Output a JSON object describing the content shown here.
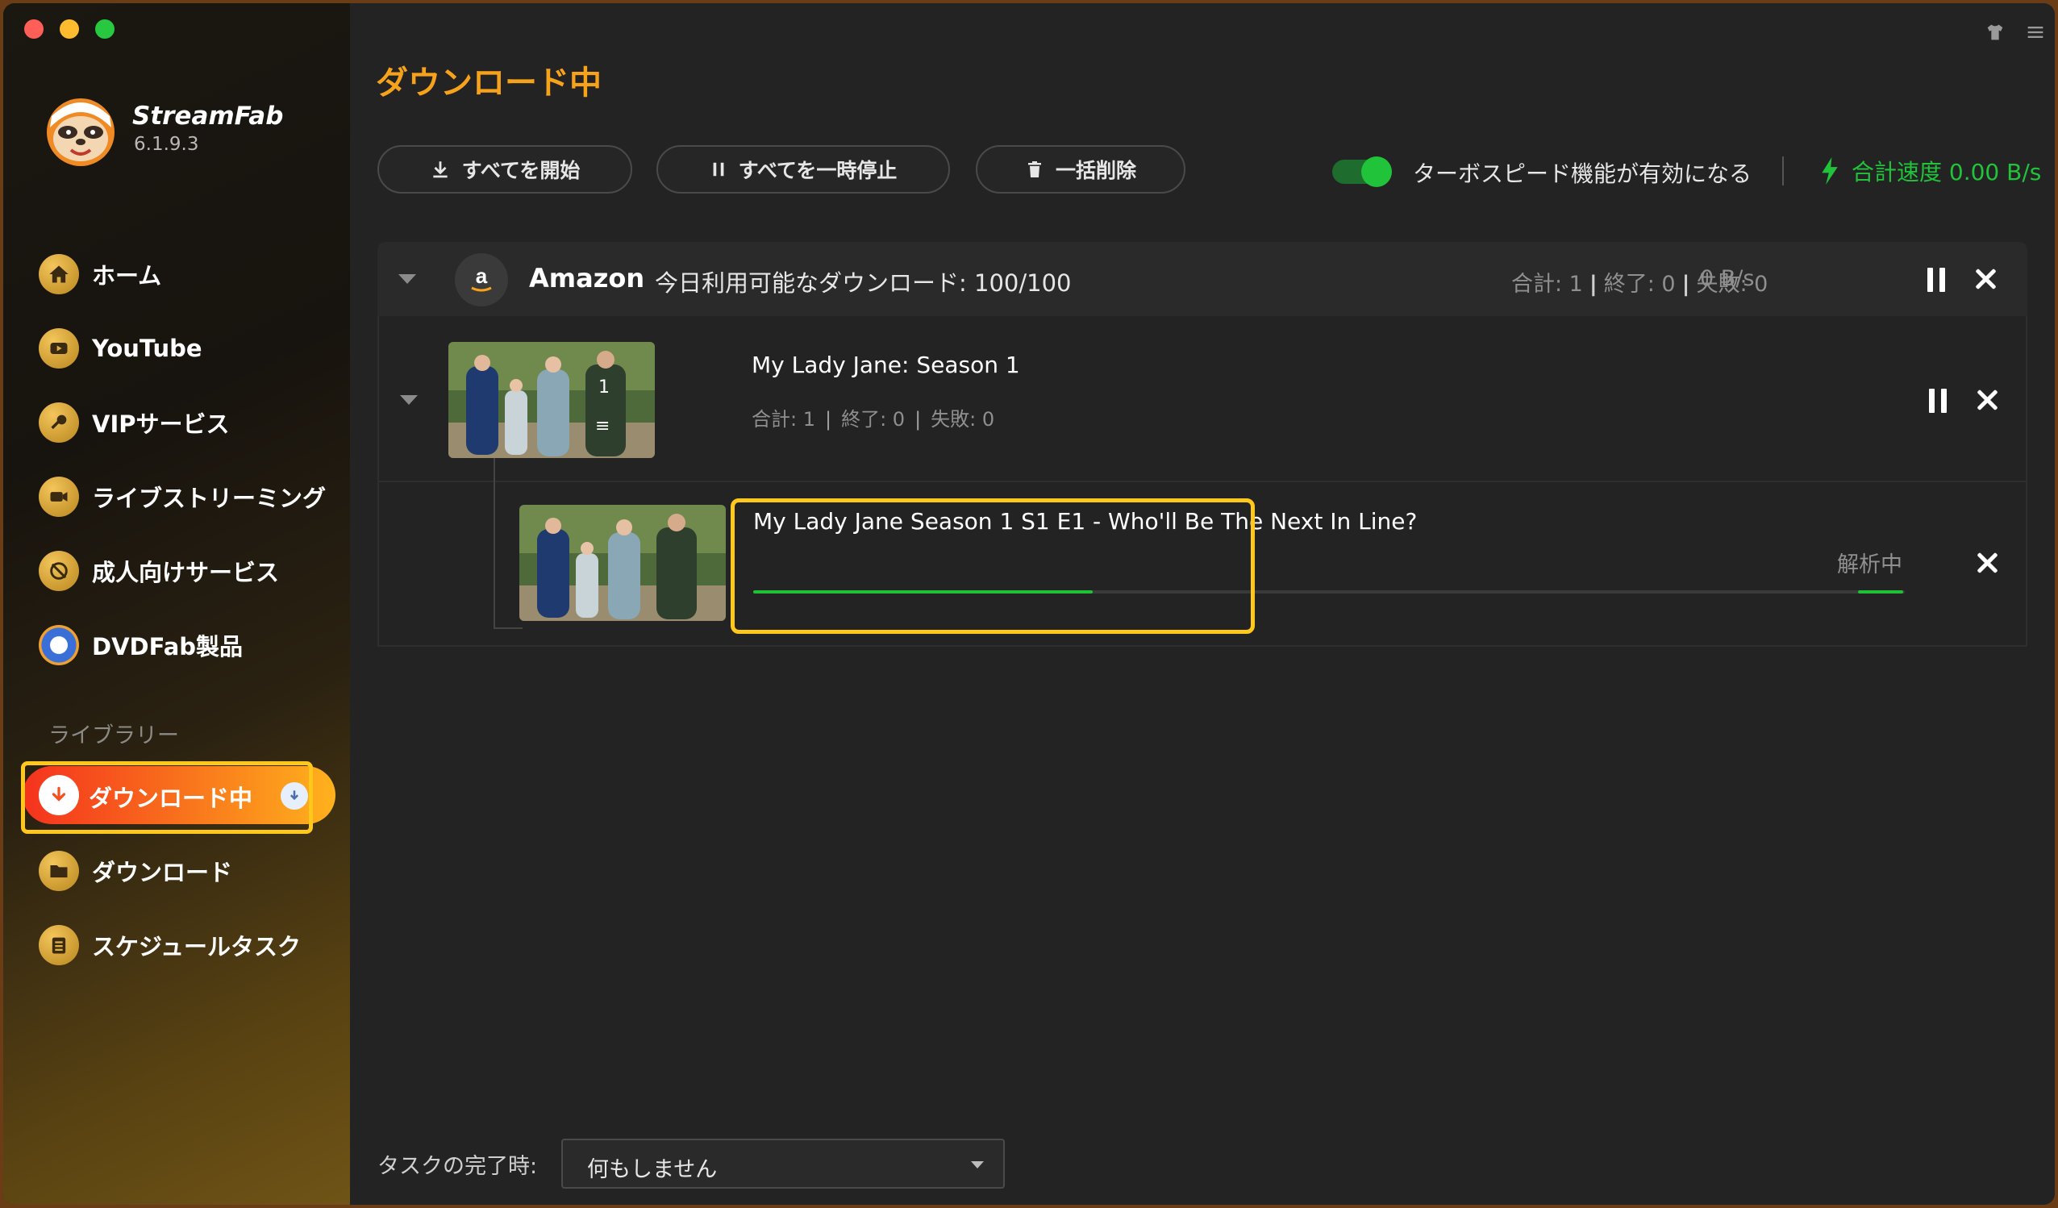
{
  "app": {
    "name": "StreamFab",
    "version": "6.1.9.3"
  },
  "sidebar": {
    "items": [
      {
        "label": "ホーム",
        "icon": "home-icon"
      },
      {
        "label": "YouTube",
        "icon": "youtube-icon"
      },
      {
        "label": "VIPサービス",
        "icon": "key-icon"
      },
      {
        "label": "ライブストリーミング",
        "icon": "camera-icon"
      },
      {
        "label": "成人向けサービス",
        "icon": "adult-icon"
      },
      {
        "label": "DVDFab製品",
        "icon": "dvdfab-icon"
      }
    ],
    "library_title": "ライブラリー",
    "library_items": [
      {
        "label": "ダウンロード中",
        "icon": "download-arrow-icon",
        "active": true
      },
      {
        "label": "ダウンロード",
        "icon": "folder-icon"
      },
      {
        "label": "スケジュールタスク",
        "icon": "clipboard-icon"
      }
    ]
  },
  "main": {
    "title": "ダウンロード中",
    "toolbar": {
      "start_all": "すべてを開始",
      "pause_all": "すべてを一時停止",
      "delete_all": "一括削除"
    },
    "turbo": {
      "label": "ターボスピード機能が有効になる",
      "enabled": true
    },
    "total_speed": "合計速度 0.00 B/s",
    "colors": {
      "accent": "#f7a21b",
      "green": "#1fbf36",
      "highlight": "#ffc81a"
    }
  },
  "group": {
    "service": "Amazon",
    "quota": "今日利用可能なダウンロード: 100/100",
    "stats": {
      "total": "合計: 1",
      "done": "終了: 0",
      "failed": "失敗: 0"
    },
    "speed": "0 B/s",
    "season": {
      "title": "My Lady Jane: Season 1",
      "count": "1",
      "stats": {
        "total": "合計: 1",
        "done": "終了: 0",
        "failed": "失敗: 0"
      }
    },
    "episode": {
      "title": "My Lady Jane Season 1 S1 E1 - Who'll Be The Next In Line?",
      "status": "解析中",
      "progress": 0.295
    }
  },
  "footer": {
    "label": "タスクの完了時:",
    "select_value": "何もしません"
  }
}
